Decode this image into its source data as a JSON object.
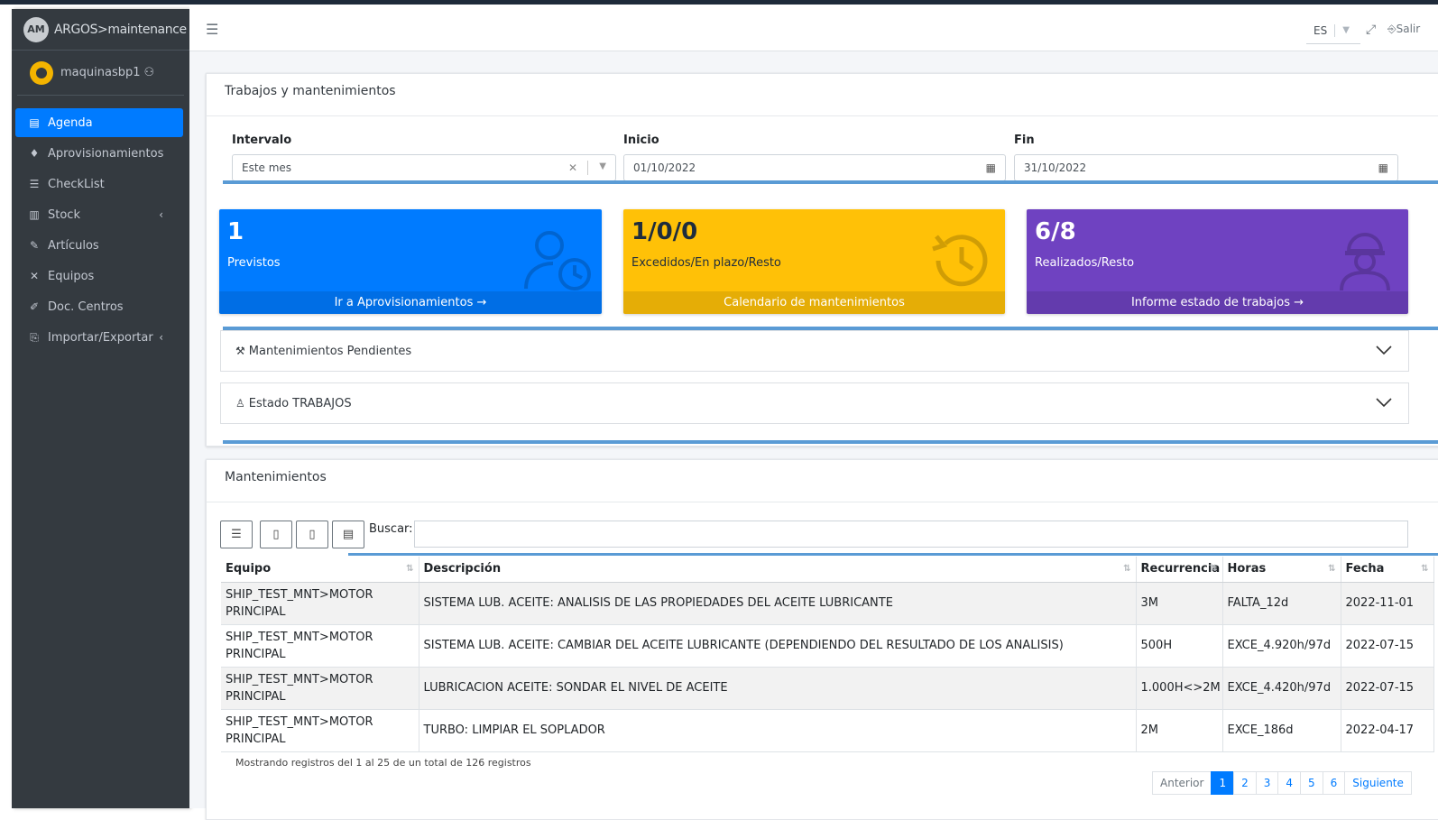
{
  "brand": {
    "logo_text": "AM",
    "name": "ARGOS>maintenance"
  },
  "user": {
    "name": "maquinasbp1"
  },
  "sidebar": {
    "items": [
      {
        "label": "Agenda",
        "icon": "calendar-icon",
        "glyph": "▤"
      },
      {
        "label": "Aprovisionamientos",
        "icon": "bell-icon",
        "glyph": "♦"
      },
      {
        "label": "CheckList",
        "icon": "checklist-icon",
        "glyph": "☰"
      },
      {
        "label": "Stock",
        "icon": "warehouse-icon",
        "glyph": "▥"
      },
      {
        "label": "Artículos",
        "icon": "pencil-icon",
        "glyph": "✎"
      },
      {
        "label": "Equipos",
        "icon": "tools-icon",
        "glyph": "✕"
      },
      {
        "label": "Doc. Centros",
        "icon": "document-icon",
        "glyph": "✐"
      },
      {
        "label": "Importar/Exportar",
        "icon": "import-export-icon",
        "glyph": "⎘"
      }
    ]
  },
  "header": {
    "language": "ES",
    "logout_label": "Salir"
  },
  "trabajos": {
    "title": "Trabajos y mantenimientos",
    "intervalo_label": "Intervalo",
    "intervalo_value": "Este mes",
    "inicio_label": "Inicio",
    "inicio_value": "01/10/2022",
    "fin_label": "Fin",
    "fin_value": "31/10/2022"
  },
  "tiles": [
    {
      "value": "1",
      "label": "Previstos",
      "footer": "Ir a Aprovisionamientos",
      "color": "#007bff"
    },
    {
      "value": "1/0/0",
      "label": "Excedidos/En plazo/Resto",
      "footer": "Calendario de mantenimientos",
      "color": "#ffc107"
    },
    {
      "value": "6/8",
      "label": "Realizados/Resto",
      "footer": "Informe estado de trabajos",
      "color": "#6f42c1"
    }
  ],
  "accordions": [
    {
      "label": "Mantenimientos Pendientes"
    },
    {
      "label": "Estado TRABAJOS"
    }
  ],
  "mantenimientos": {
    "title": "Mantenimientos",
    "search_label": "Buscar:",
    "columns": [
      "Equipo",
      "Descripción",
      "Recurrencia",
      "Horas",
      "Fecha"
    ],
    "rows": [
      {
        "equipo": "SHIP_TEST_MNT>MOTOR PRINCIPAL",
        "descripcion": "SISTEMA LUB. ACEITE: ANALISIS DE LAS PROPIEDADES DEL ACEITE LUBRICANTE",
        "recurrencia": "3M",
        "horas": "FALTA_12d",
        "fecha": "2022-11-01"
      },
      {
        "equipo": "SHIP_TEST_MNT>MOTOR PRINCIPAL",
        "descripcion": "SISTEMA LUB. ACEITE: CAMBIAR DEL ACEITE LUBRICANTE (DEPENDIENDO DEL RESULTADO DE LOS ANALISIS)",
        "recurrencia": "500H",
        "horas": "EXCE_4.920h/97d",
        "fecha": "2022-07-15"
      },
      {
        "equipo": "SHIP_TEST_MNT>MOTOR PRINCIPAL",
        "descripcion": "LUBRICACION ACEITE: SONDAR EL NIVEL DE ACEITE",
        "recurrencia": "1.000H<>2M",
        "horas": "EXCE_4.420h/97d",
        "fecha": "2022-07-15"
      },
      {
        "equipo": "SHIP_TEST_MNT>MOTOR PRINCIPAL",
        "descripcion": "TURBO: LIMPIAR EL SOPLADOR",
        "recurrencia": "2M",
        "horas": "EXCE_186d",
        "fecha": "2022-04-17"
      }
    ],
    "info": "Mostrando registros del 1 al 25 de un total de 126 registros",
    "pager": {
      "prev": "Anterior",
      "pages": [
        "1",
        "2",
        "3",
        "4",
        "5",
        "6"
      ],
      "current": "1",
      "next": "Siguiente"
    }
  }
}
